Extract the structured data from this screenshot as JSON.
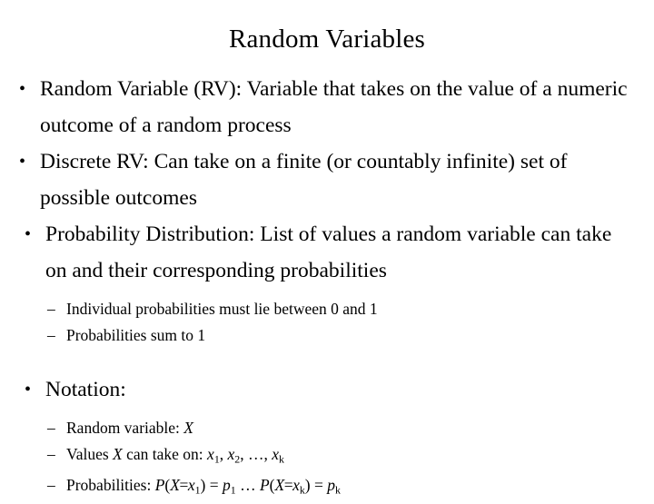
{
  "slide": {
    "title": "Random Variables",
    "bullet_glyph": "•",
    "dash_glyph": "–",
    "bullets": [
      {
        "text": "Random Variable (RV): Variable that takes on the value of a numeric outcome of a random process"
      },
      {
        "text": "Discrete RV: Can take on a finite (or countably infinite) set of possible outcomes"
      },
      {
        "text": "Probability Distribution: List of values a random variable can take on and their corresponding probabilities"
      }
    ],
    "sub_bullets": [
      {
        "text": "Individual probabilities must lie between 0 and 1"
      },
      {
        "text": "Probabilities sum to 1"
      }
    ],
    "notation_heading": "Notation:",
    "notation_items": [
      {
        "label": "Random variable:",
        "var_x": "X"
      },
      {
        "label_pre": "Values",
        "var_x": "X",
        "label_post": "can take on:",
        "values": [
          {
            "base": "x",
            "sub": "1"
          },
          {
            "base": "x",
            "sub": "2"
          }
        ],
        "ellipsis": "…",
        "last_value": {
          "base": "x",
          "sub": "k"
        },
        "comma": ",",
        "sep": ", "
      },
      {
        "label": "Probabilities:",
        "first": {
          "p": "P",
          "open": "(",
          "x_upper": "X",
          "eq": "=",
          "x_lower": "x",
          "x_sub": "1",
          "close": ")",
          "equals": "=",
          "prob": "p",
          "prob_sub": "1"
        },
        "ellipsis": "…",
        "second": {
          "p": "P",
          "open": "(",
          "x_upper": "X",
          "eq": "=",
          "x_lower": "x",
          "x_sub": "k",
          "close": ")",
          "equals": "=",
          "prob": "p",
          "prob_sub": "k"
        }
      }
    ],
    "colors": {
      "background": "#ffffff",
      "text": "#000000"
    }
  }
}
